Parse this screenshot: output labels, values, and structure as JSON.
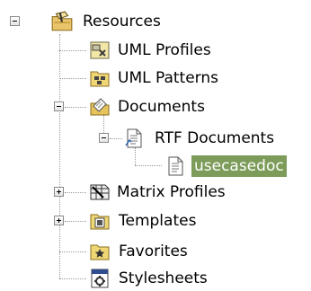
{
  "tree": {
    "root": {
      "label": "Resources",
      "expanded": true,
      "icon": "resources-folder-icon"
    },
    "items": [
      {
        "label": "UML Profiles",
        "icon": "uml-profiles-icon"
      },
      {
        "label": "UML Patterns",
        "icon": "uml-patterns-icon"
      },
      {
        "label": "Documents",
        "icon": "documents-folder-icon",
        "expanded": true,
        "children": [
          {
            "label": "RTF Documents",
            "icon": "rtf-document-icon",
            "expanded": true,
            "children": [
              {
                "label": "usecasedoc",
                "icon": "document-icon",
                "selected": true
              }
            ]
          }
        ]
      },
      {
        "label": "Matrix Profiles",
        "icon": "matrix-profiles-icon",
        "expanded": false
      },
      {
        "label": "Templates",
        "icon": "templates-icon",
        "expanded": false
      },
      {
        "label": "Favorites",
        "icon": "favorites-icon"
      },
      {
        "label": "Stylesheets",
        "icon": "stylesheets-icon"
      }
    ]
  }
}
